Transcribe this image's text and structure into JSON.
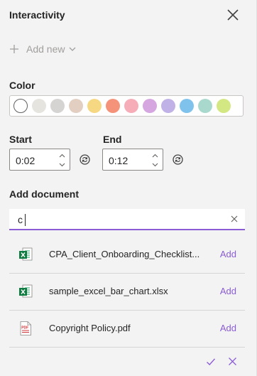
{
  "panel": {
    "title": "Interactivity",
    "add_new_label": "Add new"
  },
  "color": {
    "label": "Color",
    "swatches": [
      {
        "name": "none",
        "hex": "#ffffff",
        "selected": true
      },
      {
        "name": "light-gray-1",
        "hex": "#e6e4de"
      },
      {
        "name": "light-gray-2",
        "hex": "#d6d4d2"
      },
      {
        "name": "beige",
        "hex": "#e2cfc2"
      },
      {
        "name": "yellow",
        "hex": "#f7d882"
      },
      {
        "name": "orange",
        "hex": "#f5937a"
      },
      {
        "name": "pink",
        "hex": "#f6adb8"
      },
      {
        "name": "purple",
        "hex": "#d5a6e0"
      },
      {
        "name": "lavender",
        "hex": "#c0b1e6"
      },
      {
        "name": "blue",
        "hex": "#7fc3ec"
      },
      {
        "name": "teal",
        "hex": "#a9d9cd"
      },
      {
        "name": "lime",
        "hex": "#d3e783"
      }
    ]
  },
  "start": {
    "label": "Start",
    "value": "0:02"
  },
  "end": {
    "label": "End",
    "value": "0:12"
  },
  "document": {
    "label": "Add document",
    "search_value": "c",
    "results": [
      {
        "name": "CPA_Client_Onboarding_Checklist...",
        "type": "excel",
        "action": "Add"
      },
      {
        "name": "sample_excel_bar_chart.xlsx",
        "type": "excel",
        "action": "Add"
      },
      {
        "name": "Copyright Policy.pdf",
        "type": "pdf",
        "action": "Add"
      }
    ]
  },
  "accent": "#8a5cd6",
  "icons": {
    "close": "close-icon",
    "add": "plus-icon",
    "dropdown": "chevron-down-icon",
    "reset": "reset-icon",
    "confirm": "checkmark-icon",
    "cancel": "dismiss-icon"
  }
}
